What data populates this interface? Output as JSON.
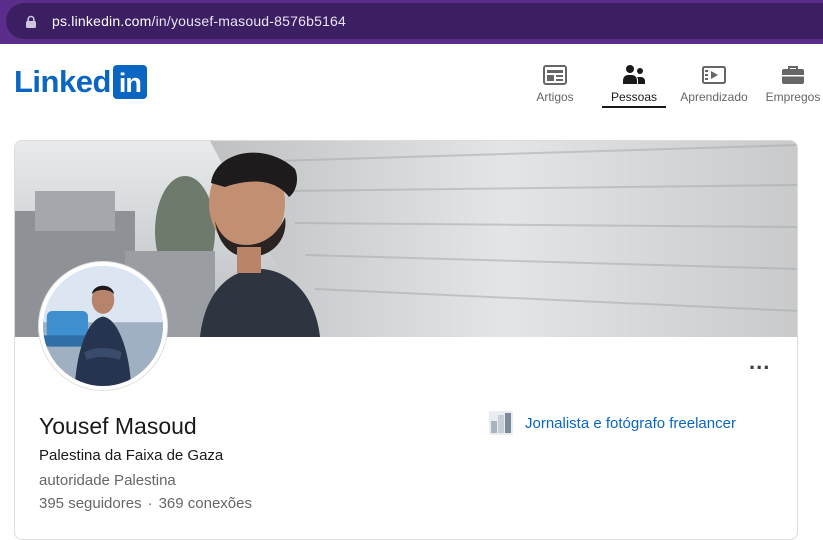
{
  "browser": {
    "url_host": "ps.linkedin.com",
    "url_path": "/in/yousef-masoud-8576b5164",
    "lock_icon": "lock-icon"
  },
  "header": {
    "logo_text": "Linked",
    "logo_box": "in",
    "brand_color": "#0a66c2",
    "nav": [
      {
        "label": "Artigos",
        "icon": "articles-icon",
        "active": false
      },
      {
        "label": "Pessoas",
        "icon": "people-icon",
        "active": true
      },
      {
        "label": "Aprendizado",
        "icon": "learning-icon",
        "active": false
      },
      {
        "label": "Empregos",
        "icon": "jobs-icon",
        "active": false
      }
    ]
  },
  "profile": {
    "name": "Yousef Masoud",
    "headline": "Palestina da Faixa de Gaza",
    "location": "autoridade Palestina",
    "followers": "395 seguidores",
    "separator": "·",
    "connections": "369 conexões",
    "more_label": "...",
    "current_position": "Jornalista e fotógrafo freelancer"
  }
}
